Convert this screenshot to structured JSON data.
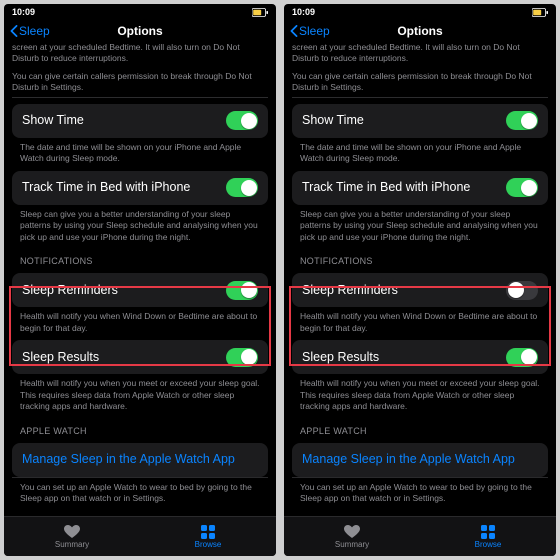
{
  "statusbar": {
    "time": "10:09"
  },
  "nav": {
    "back": "Sleep",
    "title": "Options"
  },
  "intro": {
    "line1": "screen at your scheduled Bedtime. It will also turn on Do Not Disturb to reduce interruptions.",
    "line2": "You can give certain callers permission to break through Do Not Disturb in Settings."
  },
  "rows": {
    "show_time": {
      "label": "Show Time",
      "caption": "The date and time will be shown on your iPhone and Apple Watch during Sleep mode."
    },
    "track_time": {
      "label": "Track Time in Bed with iPhone",
      "caption": "Sleep can give you a better understanding of your sleep patterns by using your Sleep schedule and analysing when you pick up and use your iPhone during the night."
    },
    "sleep_reminders": {
      "label": "Sleep Reminders",
      "caption": "Health will notify you when Wind Down or Bedtime are about to begin for that day."
    },
    "sleep_results": {
      "label": "Sleep Results",
      "caption": "Health will notify you when you meet or exceed your sleep goal. This requires sleep data from Apple Watch or other sleep tracking apps and hardware."
    },
    "apple_watch": {
      "link": "Manage Sleep in the Apple Watch App",
      "caption": "You can set up an Apple Watch to wear to bed by going to the Sleep app on that watch or in Settings."
    }
  },
  "section_headers": {
    "notifications": "NOTIFICATIONS",
    "apple_watch": "APPLE WATCH"
  },
  "tabs": {
    "summary": "Summary",
    "browse": "Browse"
  },
  "left": {
    "sleep_reminders_on": true
  },
  "right": {
    "sleep_reminders_on": false
  }
}
